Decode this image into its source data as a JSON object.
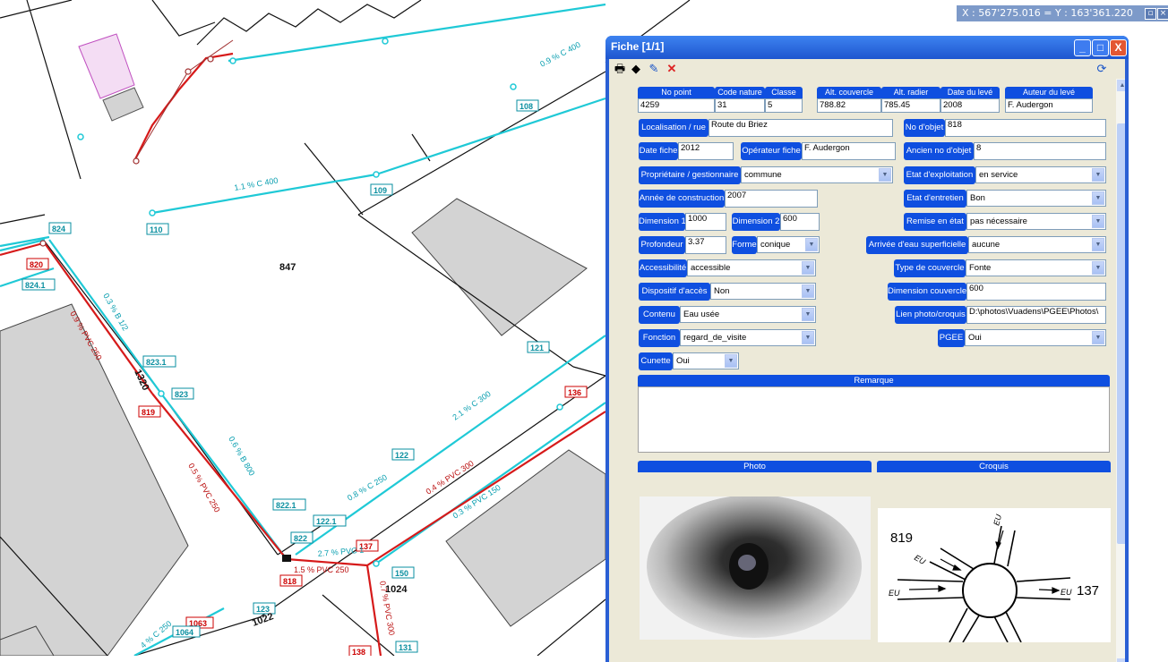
{
  "map": {
    "coord_text": "X : 567'275.016 = Y : 163'361.220",
    "parcel_label": "847",
    "node_labels": [
      "820",
      "824",
      "824.1",
      "823.1",
      "823",
      "819",
      "822.1",
      "822",
      "122.1",
      "818",
      "123",
      "1063",
      "1064",
      "137",
      "150",
      "1024",
      "131",
      "138",
      "136",
      "121",
      "122",
      "108",
      "109",
      "110"
    ],
    "road_labels": [
      "1320",
      "1022",
      "1024"
    ],
    "pipe_labels": [
      "0.9 % C 400",
      "1.1 % C 400",
      "0.9 % PVC 250",
      "0.5 % PVC 250",
      "0.6 % B 800",
      "2.1 % C 300",
      "0.8 % C 250",
      "0.4 % PVC 300",
      "0.3 % PVC 150",
      "2.7 % PVC 1",
      "1.5 % PVC 250",
      "0.7 % PVC 300",
      "4 % C 250",
      "0.3 % B 1/2"
    ]
  },
  "window": {
    "title": "Fiche [1/1]",
    "buttons": {
      "minimize": "_",
      "maximize": "□",
      "close": "X"
    }
  },
  "toolbar": {
    "icons": [
      "print-icon",
      "layers-icon",
      "edit-icon",
      "delete-icon",
      "refresh-icon"
    ]
  },
  "form": {
    "no_point": {
      "label": "No point",
      "value": "4259"
    },
    "code_nature": {
      "label": "Code nature",
      "value": "31"
    },
    "classe": {
      "label": "Classe",
      "value": "5"
    },
    "alt_couvercle": {
      "label": "Alt. couvercle",
      "value": "788.82"
    },
    "alt_radier": {
      "label": "Alt. radier",
      "value": "785.45"
    },
    "date_leve": {
      "label": "Date du levé",
      "value": "2008"
    },
    "auteur_leve": {
      "label": "Auteur du levé",
      "value": "F. Audergon"
    },
    "localisation": {
      "label": "Localisation / rue",
      "value": "Route du Briez"
    },
    "no_objet": {
      "label": "No d'objet",
      "value": "818"
    },
    "date_fiche": {
      "label": "Date fiche",
      "value": "2012"
    },
    "operateur_fiche": {
      "label": "Opérateur fiche",
      "value": "F. Audergon"
    },
    "ancien_no_objet": {
      "label": "Ancien no d'objet",
      "value": "8"
    },
    "proprietaire": {
      "label": "Propriétaire / gestionnaire",
      "value": "commune"
    },
    "etat_exploitation": {
      "label": "Etat d'exploitation",
      "value": "en service"
    },
    "annee_construction": {
      "label": "Année de construction",
      "value": "2007"
    },
    "etat_entretien": {
      "label": "Etat d'entretien",
      "value": "Bon"
    },
    "dimension1": {
      "label": "Dimension 1",
      "value": "1000"
    },
    "dimension2": {
      "label": "Dimension 2",
      "value": "600"
    },
    "remise_etat": {
      "label": "Remise en état",
      "value": "pas nécessaire"
    },
    "profondeur": {
      "label": "Profondeur",
      "value": "3.37"
    },
    "forme": {
      "label": "Forme",
      "value": "conique"
    },
    "arrivee_eau": {
      "label": "Arrivée d'eau superficielle",
      "value": "aucune"
    },
    "accessibilite": {
      "label": "Accessibilité",
      "value": "accessible"
    },
    "type_couvercle": {
      "label": "Type de couvercle",
      "value": "Fonte"
    },
    "dispositif_acces": {
      "label": "Dispositif d'accès",
      "value": "Non"
    },
    "dimension_couvercle": {
      "label": "Dimension couvercle",
      "value": "600"
    },
    "contenu": {
      "label": "Contenu",
      "value": "Eau usée"
    },
    "lien_photo": {
      "label": "Lien photo/croquis",
      "value": "D:\\photos\\Vuadens\\PGEE\\Photos\\"
    },
    "fonction": {
      "label": "Fonction",
      "value": "regard_de_visite"
    },
    "pgee": {
      "label": "PGEE",
      "value": "Oui"
    },
    "cunette": {
      "label": "Cunette",
      "value": "Oui"
    },
    "remarque": {
      "label": "Remarque",
      "value": ""
    },
    "photo": {
      "label": "Photo"
    },
    "croquis": {
      "label": "Croquis",
      "top_node": "819",
      "right_node": "137",
      "flow_label": "EU"
    }
  }
}
